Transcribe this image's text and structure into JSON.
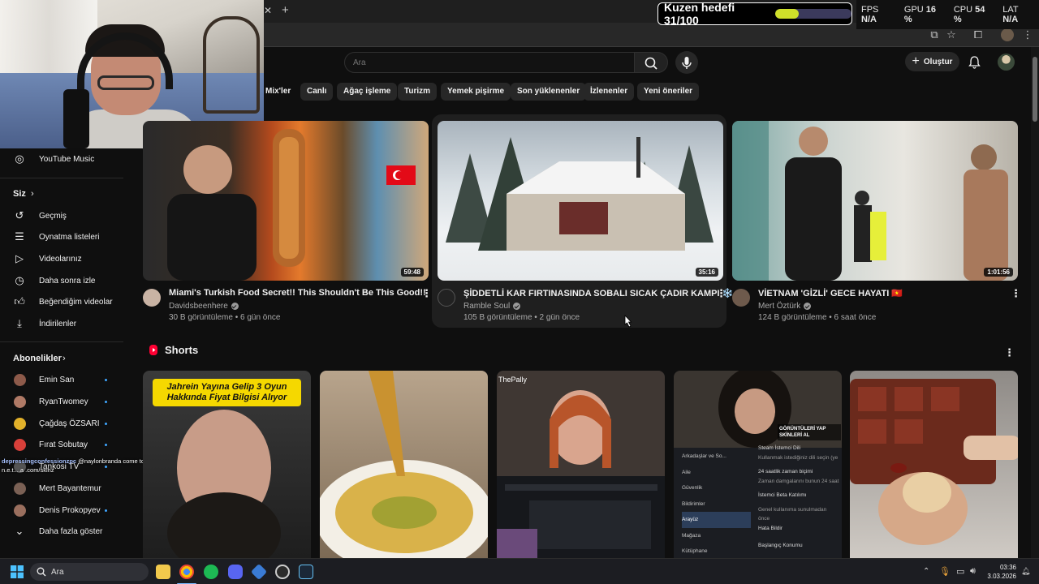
{
  "overlay": {
    "goal_text": "Kuzen hedefi 31/100",
    "progress": 0.31
  },
  "stats": [
    {
      "label": "FPS",
      "value": "N/A"
    },
    {
      "label": "GPU",
      "value": "16 %"
    },
    {
      "label": "CPU",
      "value": "54 %"
    },
    {
      "label": "LAT",
      "value": "N/A"
    }
  ],
  "search": {
    "placeholder": "Ara"
  },
  "header": {
    "create_label": "Oluştur"
  },
  "chips": [
    "Mix'ler",
    "Canlı",
    "Ağaç işleme",
    "Turizm",
    "Yemek pişirme",
    "Son yüklenenler",
    "İzlenenler",
    "Yeni öneriler"
  ],
  "sidebar": {
    "top_item": "YouTube Music",
    "you_heading": "Siz",
    "you_items": [
      "Geçmiş",
      "Oynatma listeleri",
      "Videolarınız",
      "Daha sonra izle",
      "Beğendiğim videolar",
      "İndirilenler"
    ],
    "subs_heading": "Abonelikler",
    "subs": [
      "Emin San",
      "RyanTwomey",
      "Çağdaş ÖZSARI",
      "Fırat Sobutay",
      "Tankosi TV",
      "Mert Bayantemur",
      "Denis Prokopyev"
    ],
    "more_label": "Daha fazla göster"
  },
  "chat": {
    "user": "depressingconfessionzpc",
    "message": "@naylonbranda come to us - n.e.t....a .com/skinz"
  },
  "videos": [
    {
      "title": "Miami's Turkish Food Secret!! This Shouldn't Be This Good!!",
      "channel": "Davidsbeenhere",
      "meta": "30 B görüntüleme • 6 gün önce",
      "duration": "59:48"
    },
    {
      "title": "ŞİDDETLİ KAR FIRTINASINDA SOBALI SICAK ÇADIR KAMPI ❄️",
      "channel": "Ramble Soul",
      "meta": "105 B görüntüleme • 2 gün önce",
      "duration": "35:16"
    },
    {
      "title": "VİETNAM 'GİZLİ' GECE HAYATI 🇻🇳",
      "channel": "Mert Öztürk",
      "meta": "124 B görüntüleme • 6 saat önce",
      "duration": "1:01:56"
    }
  ],
  "shorts": {
    "heading": "Shorts",
    "short1_caption": "Jahrein Yayına Gelip 3 Oyun Hakkında Fiyat Bilgisi Alıyor",
    "short3_tag": "ThePally",
    "settings_left": [
      "Arkadaşlar ve So...",
      "Aile",
      "Güvenlik",
      "Bildirimler",
      "Arayüz",
      "Mağaza",
      "Kütüphane"
    ],
    "settings_right": [
      "Steam İstemci Dili",
      "Kullanmak istediğiniz dili seçin (ye",
      "24 saatlik zaman biçimi",
      "Zaman damgalarını bunun 24 saat",
      "İstemci Beta Katılımı",
      "Genel kullanıma sunulmadan önce",
      "Hata Bildir",
      "Başlangıç Konumu"
    ],
    "short4_banner": "GÖRÜNTÜLERİ YAP SKİNLERİ AL"
  },
  "taskbar": {
    "search_label": "Ara",
    "time": "03:36",
    "date": "3.03.2026"
  },
  "colors": {
    "accent": "#ff0000",
    "progress": "#cfe02a",
    "link": "#3ea6ff"
  }
}
